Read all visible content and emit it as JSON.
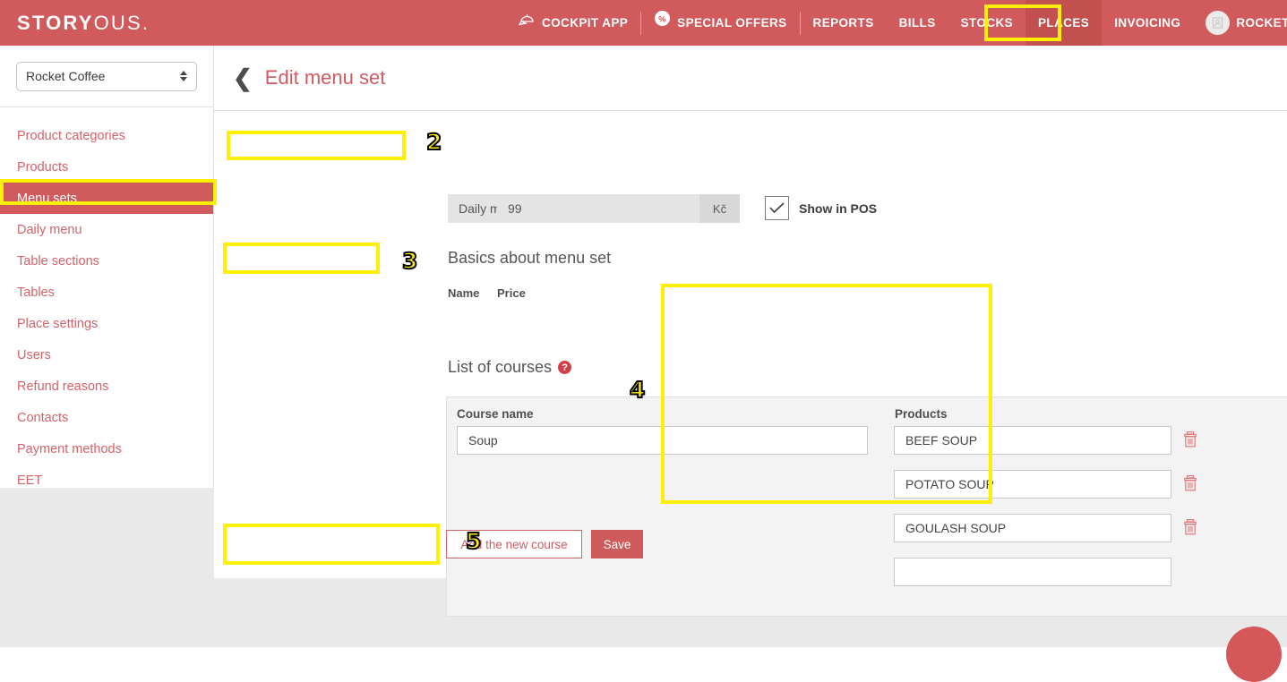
{
  "brand": {
    "bold": "STORY",
    "light": "OUS."
  },
  "topnav": {
    "items": [
      {
        "label": "COCKPIT APP",
        "icon": "cap-icon",
        "active": false
      },
      {
        "label": "SPECIAL OFFERS",
        "icon": "percent-badge-icon",
        "active": false
      },
      {
        "label": "REPORTS",
        "icon": "",
        "active": false
      },
      {
        "label": "BILLS",
        "icon": "",
        "active": false
      },
      {
        "label": "STOCKS",
        "icon": "",
        "active": false
      },
      {
        "label": "PLACES",
        "icon": "",
        "active": true
      },
      {
        "label": "INVOICING",
        "icon": "",
        "active": false
      }
    ],
    "user": {
      "label": "ROCKET",
      "icon": "user-avatar-icon"
    }
  },
  "sidebar": {
    "place_select": {
      "value": "Rocket Coffee"
    },
    "items": [
      {
        "label": "Product categories",
        "active": false
      },
      {
        "label": "Products",
        "active": false
      },
      {
        "label": "Menu sets",
        "active": true
      },
      {
        "label": "Daily menu",
        "active": false
      },
      {
        "label": "Table sections",
        "active": false
      },
      {
        "label": "Tables",
        "active": false
      },
      {
        "label": "Place settings",
        "active": false
      },
      {
        "label": "Users",
        "active": false
      },
      {
        "label": "Refund reasons",
        "active": false
      },
      {
        "label": "Contacts",
        "active": false
      },
      {
        "label": "Payment methods",
        "active": false
      },
      {
        "label": "EET",
        "active": false
      }
    ]
  },
  "page": {
    "title": "Edit menu set",
    "back_icon": "back-chevron-icon"
  },
  "basics": {
    "heading": "Basics about menu set",
    "name_label": "Name",
    "name_value": "Daily menu",
    "price_label": "Price",
    "price_value": "99",
    "price_currency": "Kč",
    "show_in_pos_label": "Show in POS",
    "show_in_pos_checked": true
  },
  "courses": {
    "heading": "List of courses",
    "help_icon": "?",
    "course_name_header": "Course name",
    "products_header": "Products",
    "rows": [
      {
        "course_name": "Soup",
        "products": [
          "BEEF SOUP",
          "POTATO SOUP",
          "GOULASH SOUP"
        ],
        "new_product_value": ""
      }
    ]
  },
  "actions": {
    "add_course_label": "Add the new course",
    "save_label": "Save"
  },
  "annotations": [
    {
      "number": "2"
    },
    {
      "number": "3"
    },
    {
      "number": "4"
    },
    {
      "number": "5"
    }
  ],
  "colors": {
    "brand_red": "#d15a5c",
    "active_nav": "#c1504f",
    "link_red": "#d4636a",
    "highlight_yellow": "#ffef00",
    "panel_gray": "#f3f3f3",
    "input_gray": "#e4e4e4"
  }
}
